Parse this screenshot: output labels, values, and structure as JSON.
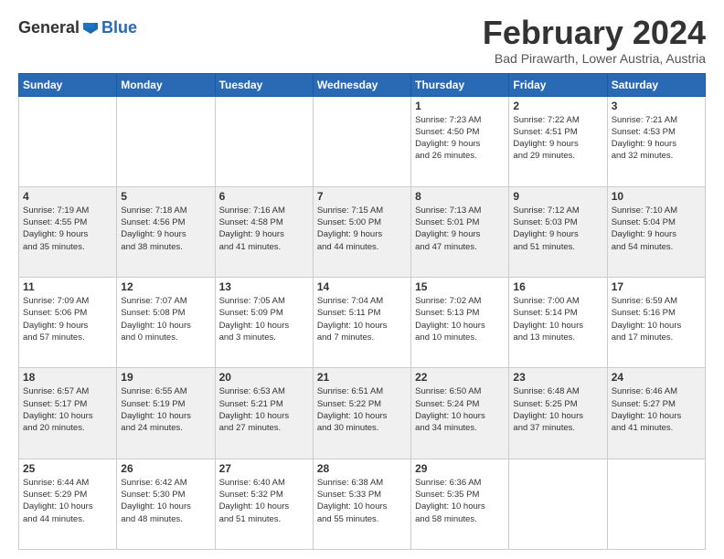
{
  "header": {
    "logo_line1": "General",
    "logo_line2": "Blue",
    "title": "February 2024",
    "subtitle": "Bad Pirawarth, Lower Austria, Austria"
  },
  "days_of_week": [
    "Sunday",
    "Monday",
    "Tuesday",
    "Wednesday",
    "Thursday",
    "Friday",
    "Saturday"
  ],
  "weeks": [
    {
      "days": [
        {
          "num": "",
          "info": ""
        },
        {
          "num": "",
          "info": ""
        },
        {
          "num": "",
          "info": ""
        },
        {
          "num": "",
          "info": ""
        },
        {
          "num": "1",
          "info": "Sunrise: 7:23 AM\nSunset: 4:50 PM\nDaylight: 9 hours\nand 26 minutes."
        },
        {
          "num": "2",
          "info": "Sunrise: 7:22 AM\nSunset: 4:51 PM\nDaylight: 9 hours\nand 29 minutes."
        },
        {
          "num": "3",
          "info": "Sunrise: 7:21 AM\nSunset: 4:53 PM\nDaylight: 9 hours\nand 32 minutes."
        }
      ]
    },
    {
      "days": [
        {
          "num": "4",
          "info": "Sunrise: 7:19 AM\nSunset: 4:55 PM\nDaylight: 9 hours\nand 35 minutes."
        },
        {
          "num": "5",
          "info": "Sunrise: 7:18 AM\nSunset: 4:56 PM\nDaylight: 9 hours\nand 38 minutes."
        },
        {
          "num": "6",
          "info": "Sunrise: 7:16 AM\nSunset: 4:58 PM\nDaylight: 9 hours\nand 41 minutes."
        },
        {
          "num": "7",
          "info": "Sunrise: 7:15 AM\nSunset: 5:00 PM\nDaylight: 9 hours\nand 44 minutes."
        },
        {
          "num": "8",
          "info": "Sunrise: 7:13 AM\nSunset: 5:01 PM\nDaylight: 9 hours\nand 47 minutes."
        },
        {
          "num": "9",
          "info": "Sunrise: 7:12 AM\nSunset: 5:03 PM\nDaylight: 9 hours\nand 51 minutes."
        },
        {
          "num": "10",
          "info": "Sunrise: 7:10 AM\nSunset: 5:04 PM\nDaylight: 9 hours\nand 54 minutes."
        }
      ]
    },
    {
      "days": [
        {
          "num": "11",
          "info": "Sunrise: 7:09 AM\nSunset: 5:06 PM\nDaylight: 9 hours\nand 57 minutes."
        },
        {
          "num": "12",
          "info": "Sunrise: 7:07 AM\nSunset: 5:08 PM\nDaylight: 10 hours\nand 0 minutes."
        },
        {
          "num": "13",
          "info": "Sunrise: 7:05 AM\nSunset: 5:09 PM\nDaylight: 10 hours\nand 3 minutes."
        },
        {
          "num": "14",
          "info": "Sunrise: 7:04 AM\nSunset: 5:11 PM\nDaylight: 10 hours\nand 7 minutes."
        },
        {
          "num": "15",
          "info": "Sunrise: 7:02 AM\nSunset: 5:13 PM\nDaylight: 10 hours\nand 10 minutes."
        },
        {
          "num": "16",
          "info": "Sunrise: 7:00 AM\nSunset: 5:14 PM\nDaylight: 10 hours\nand 13 minutes."
        },
        {
          "num": "17",
          "info": "Sunrise: 6:59 AM\nSunset: 5:16 PM\nDaylight: 10 hours\nand 17 minutes."
        }
      ]
    },
    {
      "days": [
        {
          "num": "18",
          "info": "Sunrise: 6:57 AM\nSunset: 5:17 PM\nDaylight: 10 hours\nand 20 minutes."
        },
        {
          "num": "19",
          "info": "Sunrise: 6:55 AM\nSunset: 5:19 PM\nDaylight: 10 hours\nand 24 minutes."
        },
        {
          "num": "20",
          "info": "Sunrise: 6:53 AM\nSunset: 5:21 PM\nDaylight: 10 hours\nand 27 minutes."
        },
        {
          "num": "21",
          "info": "Sunrise: 6:51 AM\nSunset: 5:22 PM\nDaylight: 10 hours\nand 30 minutes."
        },
        {
          "num": "22",
          "info": "Sunrise: 6:50 AM\nSunset: 5:24 PM\nDaylight: 10 hours\nand 34 minutes."
        },
        {
          "num": "23",
          "info": "Sunrise: 6:48 AM\nSunset: 5:25 PM\nDaylight: 10 hours\nand 37 minutes."
        },
        {
          "num": "24",
          "info": "Sunrise: 6:46 AM\nSunset: 5:27 PM\nDaylight: 10 hours\nand 41 minutes."
        }
      ]
    },
    {
      "days": [
        {
          "num": "25",
          "info": "Sunrise: 6:44 AM\nSunset: 5:29 PM\nDaylight: 10 hours\nand 44 minutes."
        },
        {
          "num": "26",
          "info": "Sunrise: 6:42 AM\nSunset: 5:30 PM\nDaylight: 10 hours\nand 48 minutes."
        },
        {
          "num": "27",
          "info": "Sunrise: 6:40 AM\nSunset: 5:32 PM\nDaylight: 10 hours\nand 51 minutes."
        },
        {
          "num": "28",
          "info": "Sunrise: 6:38 AM\nSunset: 5:33 PM\nDaylight: 10 hours\nand 55 minutes."
        },
        {
          "num": "29",
          "info": "Sunrise: 6:36 AM\nSunset: 5:35 PM\nDaylight: 10 hours\nand 58 minutes."
        },
        {
          "num": "",
          "info": ""
        },
        {
          "num": "",
          "info": ""
        }
      ]
    }
  ]
}
